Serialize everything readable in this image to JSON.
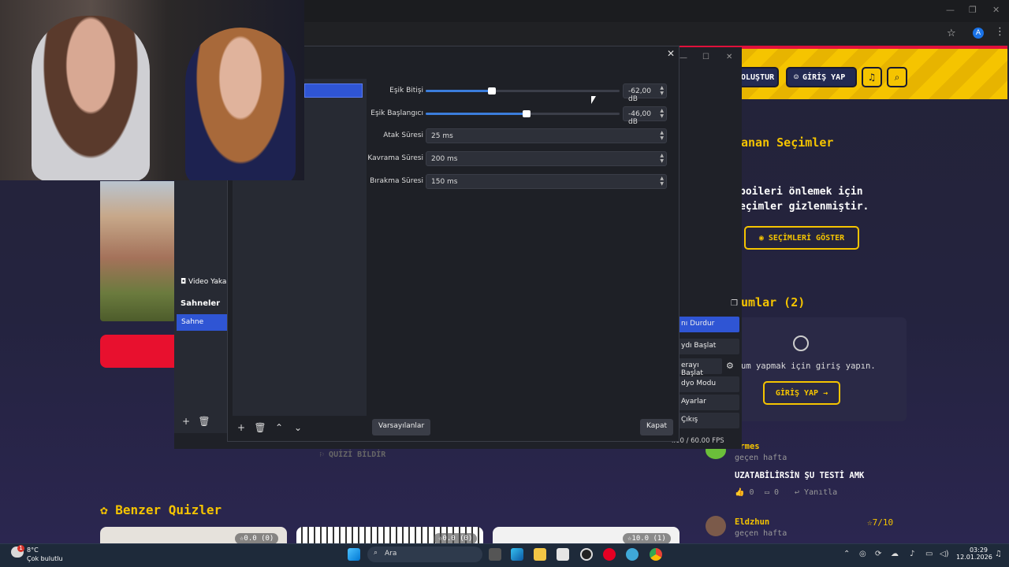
{
  "site": {
    "header_buttons": {
      "create": "OLUŞTUR",
      "login": "GİRİŞ YAP"
    },
    "selections_title": "anan Seçimler",
    "spoiler_text_1": "poileri önlemek için",
    "spoiler_text_2": "eçimler gizlenmiştir.",
    "show_selections": "SEÇİMLERİ GÖSTER",
    "comments_title": "umlar (2)",
    "comment_prompt": "um yapmak için giriş yapın.",
    "comment_login": "GİRİŞ YAP",
    "report_quiz": "QUİZİ BİLDİR",
    "similar_title": "Benzer Quizler",
    "comments": [
      {
        "user": "ermes",
        "time": "geçen hafta",
        "text": "UZATABİLİRSİN ŞU TESTİ AMK",
        "likes": "0",
        "replies": "0",
        "reply_label": "Yanıtla"
      },
      {
        "user": "Eldzhun",
        "time": "geçen hafta",
        "score": "7/10"
      }
    ],
    "quiz_badges": [
      "0.0 (0)",
      "0.0 (0)",
      "10.0 (1)"
    ]
  },
  "obs": {
    "source_label": "Video Yaka",
    "scenes_title": "Sahneler",
    "scene_item": "Sahne",
    "controls": [
      "nı Durdur",
      "ydı Başlat",
      "erayı Başlat",
      "dyo Modu",
      "Ayarlar",
      "Çıkış"
    ],
    "fps": "i.00 / 60.00 FPS"
  },
  "dialog": {
    "fields": [
      {
        "label": "Eşik Bitişi",
        "value": "-62,00 dB",
        "level": 0.34
      },
      {
        "label": "Eşik Başlangıcı",
        "value": "-46,00 dB",
        "level": 0.52
      }
    ],
    "spin_fields": [
      {
        "label": "Atak Süresi",
        "value": "25 ms"
      },
      {
        "label": "Kavrama Süresi",
        "value": "200 ms"
      },
      {
        "label": "Bırakma Süresi",
        "value": "150 ms"
      }
    ],
    "defaults_button": "Varsayılanlar",
    "close_button": "Kapat"
  },
  "taskbar": {
    "temp": "8°C",
    "weather": "Çok bulutlu",
    "search_placeholder": "Ara",
    "time": "03:29",
    "date": "12.01.2026",
    "notification_count": "1"
  }
}
